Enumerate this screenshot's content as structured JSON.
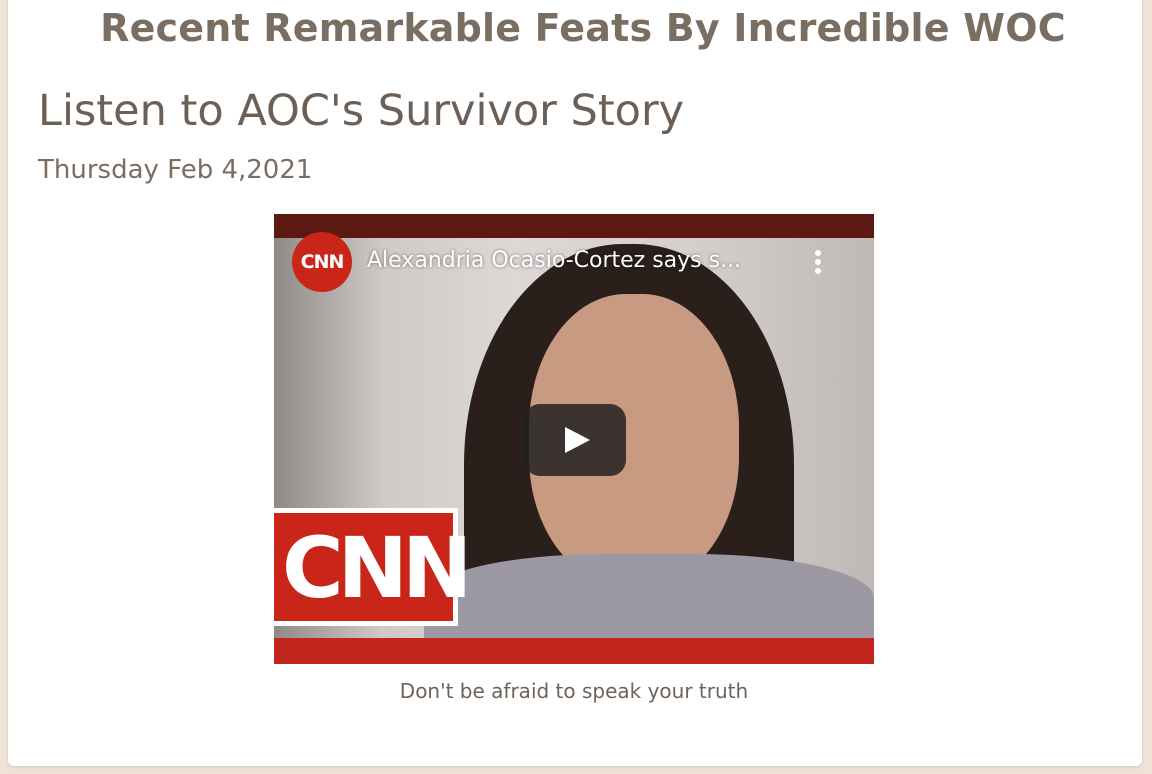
{
  "header": {
    "section_title": "Recent Remarkable Feats By Incredible WOC"
  },
  "post": {
    "title": "Listen to AOC's Survivor Story",
    "date": "Thursday Feb 4,2021",
    "caption": "Don't be afraid to speak your truth"
  },
  "video": {
    "channel_logo_text": "CNN",
    "title": "Alexandria Ocasio-Cortez says s...",
    "watermark_text": "CNN"
  },
  "icons": {
    "more": "more-vertical-icon",
    "play": "play-icon"
  },
  "colors": {
    "text": "#6e6259",
    "rule": "#7a6e63",
    "background": "#efe3d6",
    "cnn_red": "#c92519"
  }
}
